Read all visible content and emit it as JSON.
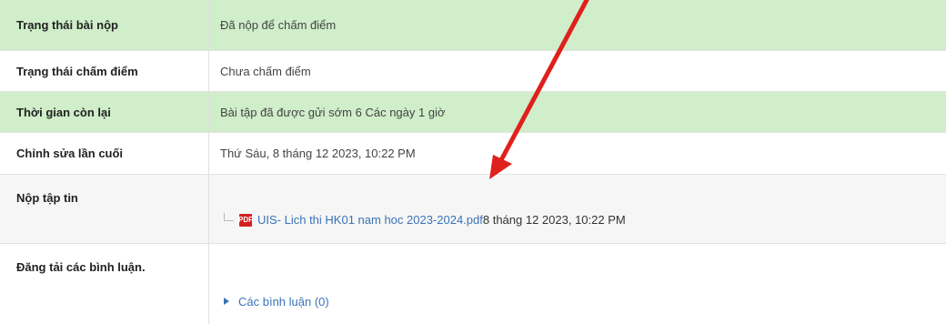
{
  "submission_table": {
    "rows": [
      {
        "label": "Trạng thái bài nộp",
        "value": "Đã nộp để chấm điểm"
      },
      {
        "label": "Trạng thái chấm điểm",
        "value": "Chưa chấm điểm"
      },
      {
        "label": "Thời gian còn lại",
        "value": "Bài tập đã được gửi sớm 6 Các ngày 1 giờ"
      },
      {
        "label": "Chỉnh sửa lần cuối",
        "value": "Thứ Sáu, 8 tháng 12 2023, 10:22 PM"
      },
      {
        "label": "Nộp tập tin",
        "file_name": "UIS- Lich thi HK01 nam hoc 2023-2024.pdf",
        "file_date": "8 tháng 12 2023, 10:22 PM"
      },
      {
        "label": "Đăng tải các bình luận.",
        "comments_link": "Các bình luận (0)"
      }
    ]
  },
  "colors": {
    "status_green": "#cfeec9",
    "link_blue": "#3a73b8",
    "annotation_arrow": "#e0201c",
    "pdf_red": "#d42020"
  },
  "icons": {
    "file": "pdf-file-icon",
    "expand": "triangle-right-icon"
  }
}
